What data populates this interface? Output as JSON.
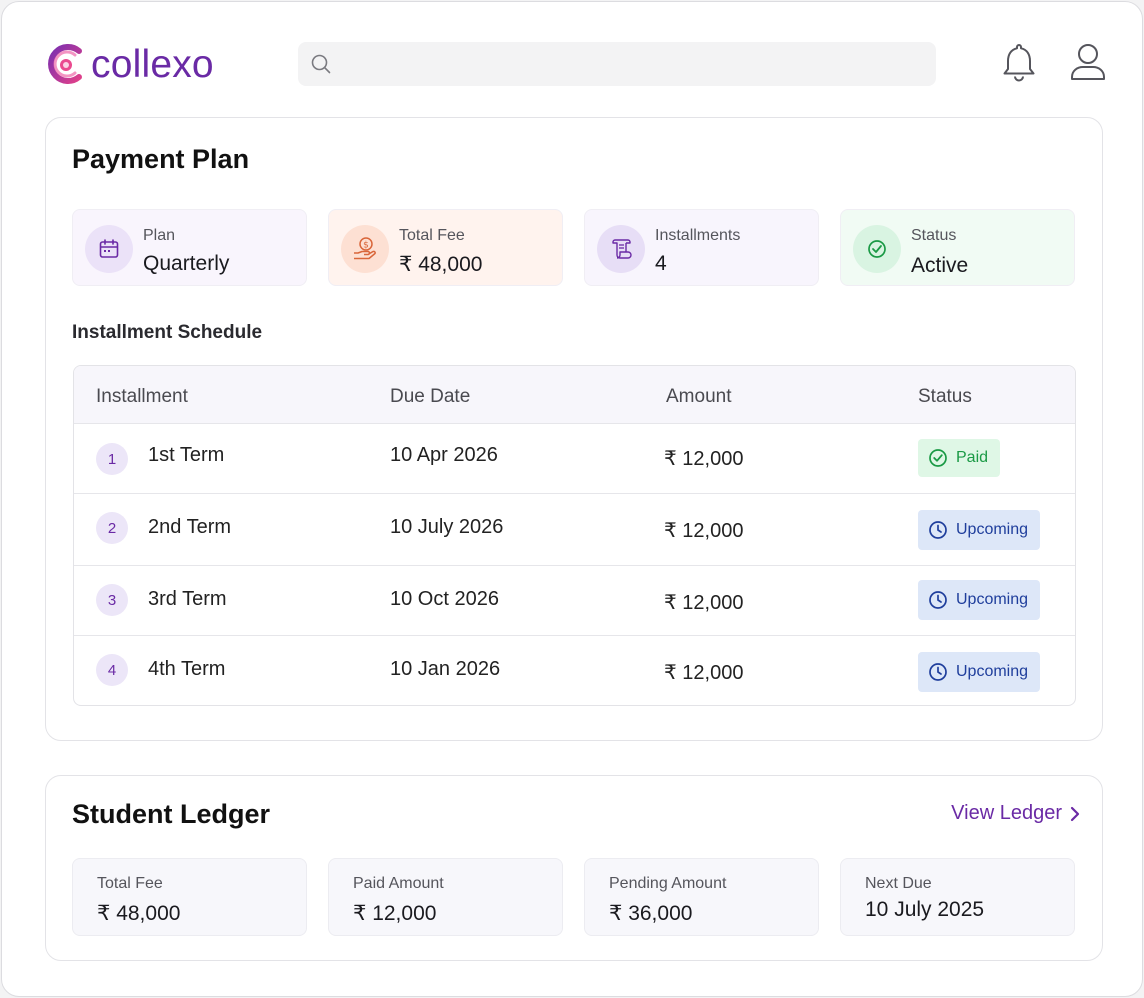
{
  "header": {
    "brand": "collexo",
    "search_placeholder": ""
  },
  "plan": {
    "title": "Payment Plan",
    "stats": [
      {
        "label": "Plan",
        "value": "Quarterly",
        "icon": "calendar-icon",
        "bg": "#f9f5fd",
        "icon_bg": "#ebe2f8",
        "icon_color": "#6a2aa5"
      },
      {
        "label": "Total Fee",
        "value": "₹ 48,000",
        "icon": "money-hand-icon",
        "bg": "#fff3ee",
        "icon_bg": "#fde0d3",
        "icon_color": "#d9663a"
      },
      {
        "label": "Installments",
        "value": "4",
        "icon": "scroll-icon",
        "bg": "#f8f5fd",
        "icon_bg": "#e7def6",
        "icon_color": "#6a2aa5"
      },
      {
        "label": "Status",
        "value": "Active",
        "icon": "check-circle-icon",
        "bg": "#f1fbf4",
        "icon_bg": "#d9f4e2",
        "icon_color": "#1a9a45"
      }
    ],
    "schedule_label": "Installment Schedule",
    "table": {
      "headers": [
        "Installment",
        "Due Date",
        "Amount",
        "Status"
      ],
      "rows": [
        {
          "num": "1",
          "term": "1st Term",
          "due": "10 Apr 2026",
          "amount": "₹ 12,000",
          "status": "Paid",
          "kind": "paid"
        },
        {
          "num": "2",
          "term": "2nd Term",
          "due": "10 July 2026",
          "amount": "₹ 12,000",
          "status": "Upcoming",
          "kind": "upcoming"
        },
        {
          "num": "3",
          "term": "3rd Term",
          "due": "10 Oct 2026",
          "amount": "₹ 12,000",
          "status": "Upcoming",
          "kind": "upcoming"
        },
        {
          "num": "4",
          "term": "4th Term",
          "due": "10 Jan 2026",
          "amount": "₹ 12,000",
          "status": "Upcoming",
          "kind": "upcoming"
        }
      ]
    }
  },
  "ledger": {
    "title": "Student Ledger",
    "view_link": "View Ledger",
    "stats": [
      {
        "label": "Total Fee",
        "value": "₹ 48,000"
      },
      {
        "label": "Paid Amount",
        "value": "₹ 12,000"
      },
      {
        "label": "Pending Amount",
        "value": "₹ 36,000"
      },
      {
        "label": "Next Due",
        "value": "10 July 2025"
      }
    ]
  },
  "colors": {
    "brand": "#6a2aa5",
    "paid": "#1a9a45",
    "upcoming": "#1f3e9c"
  }
}
